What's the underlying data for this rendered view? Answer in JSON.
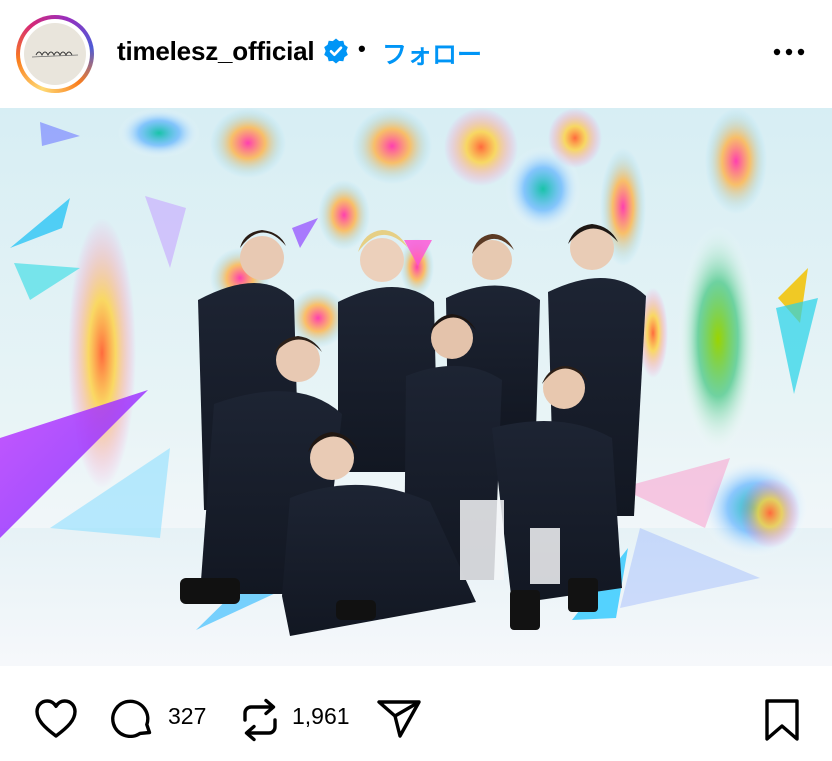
{
  "post": {
    "username": "timelesz_official",
    "separator": "•",
    "follow_label": "フォロー",
    "avatar_text": "timelesz",
    "verified_icon": "verified-badge-icon",
    "more_icon": "more-options-icon"
  },
  "photo": {
    "alt": "timelesz group photo"
  },
  "actions": {
    "comments_count": "327",
    "reposts_count": "1,961",
    "like_icon": "heart-icon",
    "comment_icon": "comment-icon",
    "repost_icon": "repost-icon",
    "share_icon": "share-icon",
    "save_icon": "bookmark-icon"
  },
  "colors": {
    "follow": "#0095f6",
    "verified": "#0095f6"
  }
}
